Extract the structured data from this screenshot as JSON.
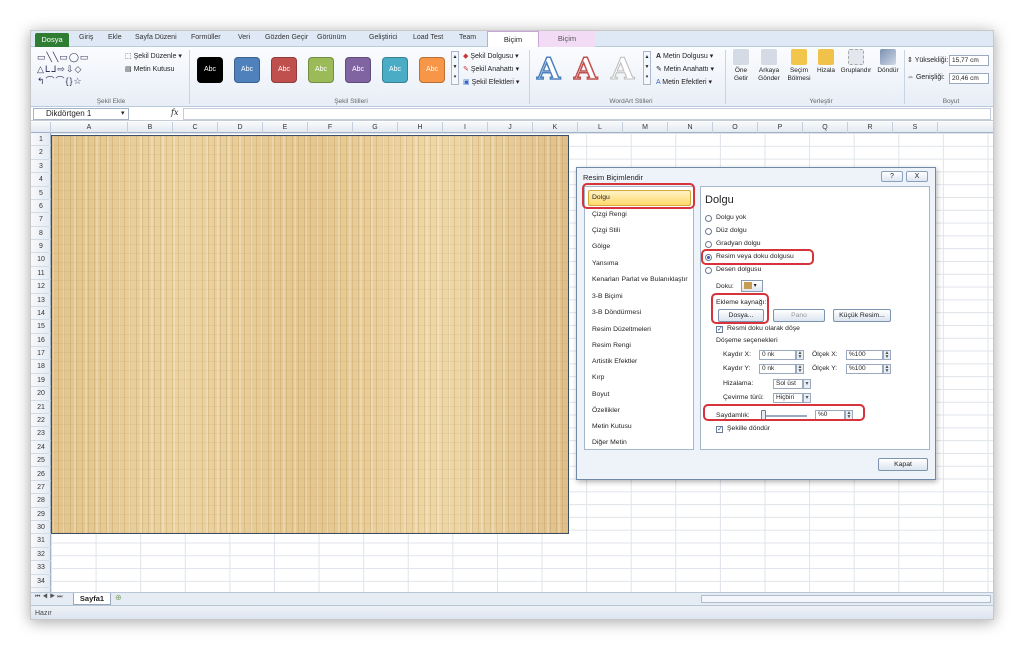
{
  "tabs": [
    "Dosya",
    "Giriş",
    "Ekle",
    "Sayfa Düzeni",
    "Formüller",
    "Veri",
    "Gözden Geçir",
    "Görünüm",
    "Geliştirici",
    "Load Test",
    "Team",
    "Biçim",
    "Biçim"
  ],
  "ribbon": {
    "shape_edit": "Şekil Düzenle",
    "text_box": "Metin Kutusu",
    "group_insert_shapes": "Şekil Ekle",
    "style_label": "Abc",
    "shape_fill": "Şekil Dolgusu",
    "shape_outline": "Şekil Anahattı",
    "shape_effects": "Şekil Efektleri",
    "group_shape_styles": "Şekil Stilleri",
    "wordart_letter": "A",
    "text_fill": "Metin Dolgusu",
    "text_outline": "Metin Anahattı",
    "text_effects": "Metin Efektleri",
    "group_wordart": "WordArt Stilleri",
    "bring_forward": "Öne Getir",
    "send_backward": "Arkaya Gönder",
    "selection_pane": "Seçim Bölmesi",
    "align": "Hizala",
    "group": "Gruplandır",
    "rotate": "Döndür",
    "group_arrange": "Yerleştir",
    "height_label": "Yüksekliği:",
    "height_value": "15,77 cm",
    "width_label": "Genişliği:",
    "width_value": "20,46 cm",
    "group_size": "Boyut"
  },
  "formula_bar": {
    "name_box": "Dikdörtgen 1",
    "fx": "fx"
  },
  "columns": [
    "A",
    "B",
    "C",
    "D",
    "E",
    "F",
    "G",
    "H",
    "I",
    "J",
    "K",
    "L",
    "M",
    "N",
    "O",
    "P",
    "Q",
    "R",
    "S"
  ],
  "rows": [
    "1",
    "2",
    "3",
    "4",
    "5",
    "6",
    "7",
    "8",
    "9",
    "10",
    "11",
    "12",
    "13",
    "14",
    "15",
    "16",
    "17",
    "18",
    "19",
    "20",
    "21",
    "22",
    "23",
    "24",
    "25",
    "26",
    "27",
    "28",
    "29",
    "30",
    "31",
    "32",
    "33",
    "34"
  ],
  "sheet": {
    "tab": "Sayfa1",
    "status": "Hazır"
  },
  "dialog": {
    "title": "Resim Biçimlendir",
    "help": "?",
    "close_x": "X",
    "categories": [
      "Dolgu",
      "Çizgi Rengi",
      "Çizgi Stili",
      "Gölge",
      "Yansıma",
      "Kenarları Parlat ve Bulanıklaştır",
      "3-B Biçimi",
      "3-B Döndürmesi",
      "Resim Düzeltmeleri",
      "Resim Rengi",
      "Artistik Efektler",
      "Kırp",
      "Boyut",
      "Özellikler",
      "Metin Kutusu",
      "Diğer Metin"
    ],
    "panel_title": "Dolgu",
    "options": [
      "Dolgu yok",
      "Düz dolgu",
      "Gradyan dolgu",
      "Resim veya doku dolgusu",
      "Desen dolgusu"
    ],
    "texture_label": "Doku:",
    "insert_from": "Ekleme kaynağı:",
    "file_button": "Dosya...",
    "clipboard_button": "Pano",
    "clipart_button": "Küçük Resim...",
    "tile_checkbox": "Resmi doku olarak döşe",
    "tiling_options": "Döşeme seçenekleri",
    "offset_x_label": "Kaydır X:",
    "offset_x": "0 nk",
    "offset_y_label": "Kaydır Y:",
    "offset_y": "0 nk",
    "scale_x_label": "Ölçek X:",
    "scale_x": "%100",
    "scale_y_label": "Ölçek Y:",
    "scale_y": "%100",
    "alignment_label": "Hizalama:",
    "alignment": "Sol üst",
    "mirror_label": "Çevirme türü:",
    "mirror": "Hiçbiri",
    "transparency_label": "Saydamlık:",
    "transparency": "%0",
    "rotate_checkbox": "Şekille döndür",
    "close_button": "Kapat"
  }
}
